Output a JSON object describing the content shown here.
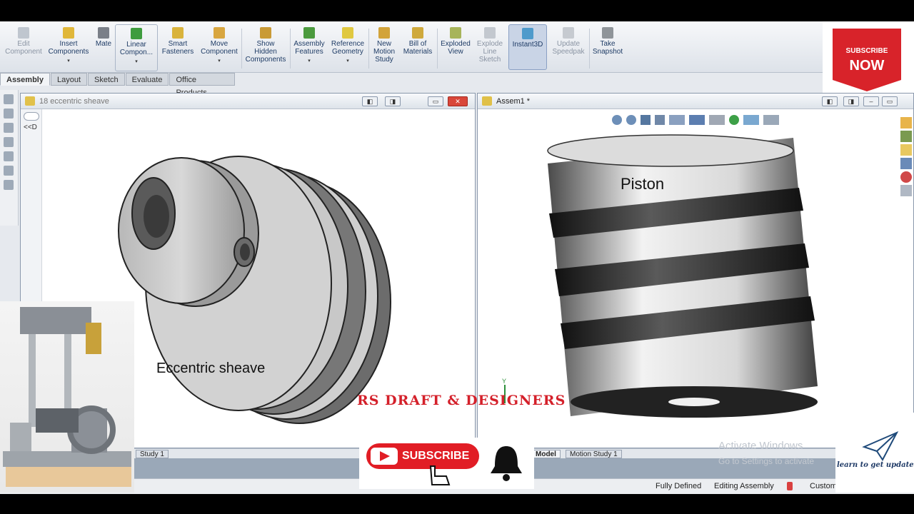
{
  "toolbar": {
    "items": [
      {
        "label": "Edit\nComponent",
        "dim": true
      },
      {
        "label": "Insert\nComponents",
        "dim": false
      },
      {
        "label": "Mate",
        "dim": false
      },
      {
        "label": "Linear\nCompon...",
        "dim": false
      },
      {
        "label": "Smart\nFasteners",
        "dim": false
      },
      {
        "label": "Move\nComponent",
        "dim": false
      },
      {
        "label": "Show\nHidden\nComponents",
        "dim": false
      },
      {
        "label": "Assembly\nFeatures",
        "dim": false
      },
      {
        "label": "Reference\nGeometry",
        "dim": false
      },
      {
        "label": "New\nMotion\nStudy",
        "dim": false
      },
      {
        "label": "Bill of\nMaterials",
        "dim": false
      },
      {
        "label": "Exploded\nView",
        "dim": false
      },
      {
        "label": "Explode\nLine\nSketch",
        "dim": true
      },
      {
        "label": "Instant3D",
        "dim": false
      },
      {
        "label": "Update\nSpeedpak",
        "dim": true
      },
      {
        "label": "Take\nSnapshot",
        "dim": false
      }
    ]
  },
  "tabs": [
    "Assembly",
    "Layout",
    "Sketch",
    "Evaluate",
    "Office Products"
  ],
  "left_window": {
    "title": "18 eccentric sheave",
    "tree_text": "<<D",
    "part_label": "Eccentric sheave"
  },
  "right_window": {
    "title": "Assem1 *",
    "part_label": "Piston"
  },
  "bottom_tabs": {
    "left": "Study 1",
    "model": "Model",
    "motion": "Motion Study 1"
  },
  "status": {
    "fully_defined": "Fully Defined",
    "editing": "Editing Assembly",
    "custom": "Custom"
  },
  "watermark": {
    "line1": "Activate Windows",
    "line2": "Go to Settings to activate"
  },
  "overlays": {
    "brand": "RS DRAFT & DESIGNERS",
    "subscribe_now_top": "SUBSCRIBE",
    "subscribe_now_bottom": "NOW",
    "subscribe_button": "SUBSCRIBE",
    "learn": "learn to get update"
  },
  "colors": {
    "accent_red": "#d4202a",
    "toolbar_text": "#1f3c66"
  }
}
